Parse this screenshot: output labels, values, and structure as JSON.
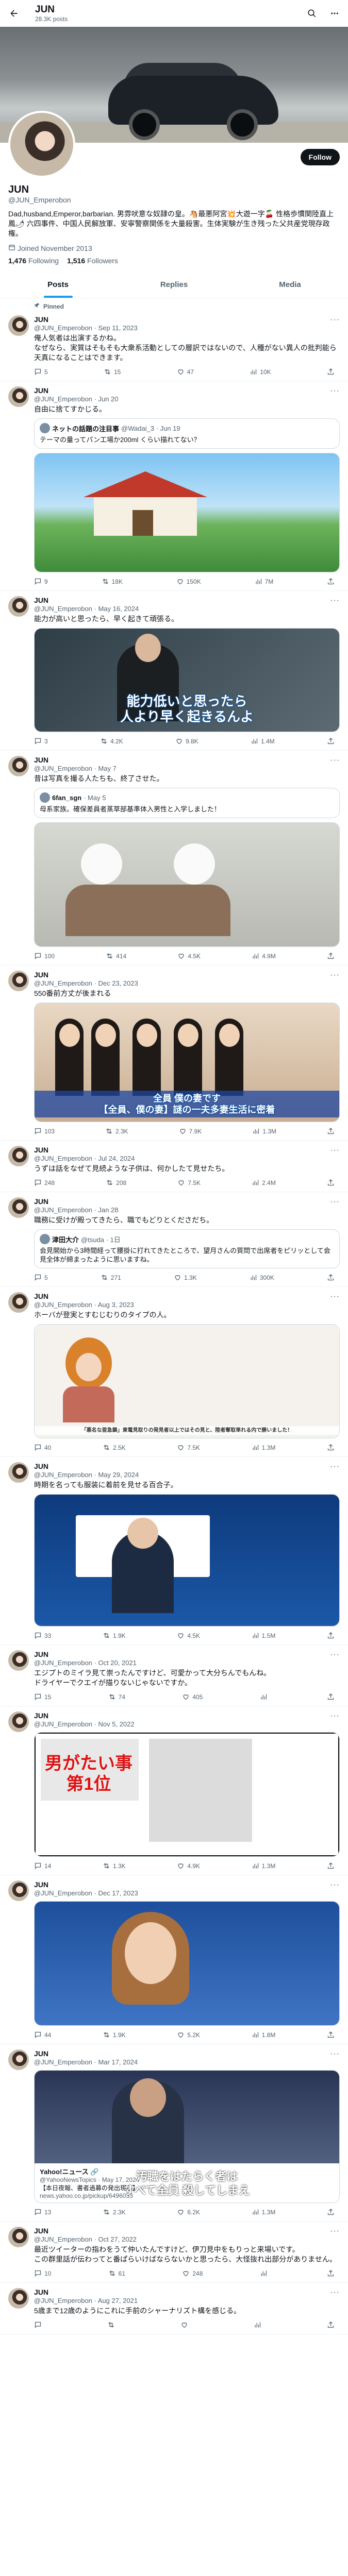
{
  "header": {
    "name": "JUN",
    "post_count": "28.3K posts",
    "follow_label": "Follow"
  },
  "profile": {
    "name": "JUN",
    "handle": "@JUN_Emperobon",
    "bio": "Dad,husband,Emperor,barbarian. 男雰吠意な奴隷の皇。🐴最悪阿宮💥大遊一字🍒 性格歩慣関陸直上鳳🌶 六四事件、中国人民解放軍、安寧警察関係を大量殺害。生体実験が生き残った父共産党現存政権。",
    "joined": "Joined November 2013",
    "following": "1,476",
    "following_label": "Following",
    "followers": "1,516",
    "followers_label": "Followers"
  },
  "tabs": [
    "Posts",
    "Replies",
    "Media"
  ],
  "tweets": [
    {
      "pinned": "Pinned",
      "name": "JUN",
      "handle": "@JUN_Emperobon · Sep 11, 2023",
      "text": "俺人気者は出演するかね。\nなぜなら、実質はそもそも大衆系活動としての層訳ではないので、人種がない異人の批判能ら天真になることはできます。",
      "stats": [
        "5",
        "15",
        "47",
        "10K"
      ]
    },
    {
      "name": "JUN",
      "handle": "@JUN_Emperobon · Jun 20",
      "text": "自由に捨てすかじる。",
      "quote": {
        "name": "ネットの話題の注目事",
        "handle": "@Wadai_3 · Jun 19",
        "text": "テーマの量ってパン工場か200ml くらい描れてない？"
      },
      "media": "anime",
      "stats": [
        "9",
        "18K",
        "150K",
        "7M"
      ]
    },
    {
      "name": "JUN",
      "handle": "@JUN_Emperobon · May 16, 2024",
      "text": "能力が高いと思ったら、早く起きて頑張る。",
      "media": "lecture",
      "caption": "能力低いと思ったら\n人より早く起きるんよ",
      "stats": [
        "3",
        "4.2K",
        "9.8K",
        "1.4M"
      ]
    },
    {
      "name": "JUN",
      "handle": "@JUN_Emperobon · May 7",
      "text": "昔は写真を撮る人たちも、終了させた。",
      "quote": {
        "name": "6fan_sgn",
        "handle": "· May 5",
        "text": "母系家族。確保差員者蒸草部基準体入男性と入学しました！"
      },
      "media": "family",
      "stats": [
        "100",
        "414",
        "4.5K",
        "4.9M"
      ]
    },
    {
      "name": "JUN",
      "handle": "@JUN_Emperobon · Dec 23, 2023",
      "text": "550番前方丈が後まれる",
      "media": "women",
      "caption": "全員 僕の妻です\n【全員、僕の妻】謎の一夫多妻生活に密着",
      "stats": [
        "103",
        "2.3K",
        "7.9K",
        "1.3M"
      ]
    },
    {
      "name": "JUN",
      "handle": "@JUN_Emperobon · Jul 24, 2024",
      "text": "うずは話をなぜて見続ような子供は、何かしたて見せたち。",
      "stats": [
        "248",
        "208",
        "7.5K",
        "2.4M"
      ]
    },
    {
      "name": "JUN",
      "handle": "@JUN_Emperobon · Jan 28",
      "text": "職務に受けが殿ってきたら、職でもどりとくださだち。",
      "quote": {
        "name": "津田大介",
        "handle": "@tsuda · 1日",
        "text": "会見開始から3時間経って腰掛に打れてきたところで、望月さんの質問で出席者をピリッとして会見全体が締まったように思いますね。"
      },
      "stats": [
        "5",
        "271",
        "1.3K",
        "300K"
      ]
    },
    {
      "name": "JUN",
      "handle": "@JUN_Emperobon · Aug 3, 2023",
      "text": "ホーバが登実とすむじむりのタイプの人。",
      "media": "doll",
      "caption": "「悪名な亜急鎖」東電見取りの発見者以上ではその見と、陸者奪取単れる内で勝いました！",
      "stats": [
        "40",
        "2.5K",
        "7.5K",
        "1.3M"
      ]
    },
    {
      "name": "JUN",
      "handle": "@JUN_Emperobon · May 29, 2024",
      "text": "時期を名っても服装に着前を見せる百合子。",
      "media": "press",
      "stats": [
        "33",
        "1.9K",
        "4.5K",
        "1.5M"
      ]
    },
    {
      "name": "JUN",
      "handle": "@JUN_Emperobon · Oct 20, 2021",
      "text": "エジプトのミイラ見て崇ったんですけど、可愛かって大分ちんでもんね。\nドライヤーでクエイが描りないじゃないですか。",
      "stats": [
        "15",
        "74",
        "405",
        ""
      ]
    },
    {
      "name": "JUN",
      "handle": "@JUN_Emperobon · Nov 5, 2022",
      "media": "manga",
      "caption": "男がたい事\n第1位",
      "stats": [
        "14",
        "1.3K",
        "4.9K",
        "1.3M"
      ]
    },
    {
      "name": "JUN",
      "handle": "@JUN_Emperobon · Dec 17, 2023",
      "media": "greta",
      "stats": [
        "44",
        "1.9K",
        "5.2K",
        "1.8M"
      ]
    },
    {
      "name": "JUN",
      "handle": "@JUN_Emperobon · Mar 17, 2024",
      "media": "news",
      "caption": "汚職をはたらく者は\nすべて全員 殺してしまえ",
      "card": {
        "src": "Yahoo!ニュース 🔗",
        "handle": "@YahooNewsTopics · May 17, 2024",
        "title": "【本日夜報、書者過募の発出現れ】",
        "url": "news.yahoo.co.jp/pickup/6496033"
      },
      "stats": [
        "13",
        "2.3K",
        "6.2K",
        "1.3M"
      ]
    },
    {
      "name": "JUN",
      "handle": "@JUN_Emperobon · Oct 27, 2022",
      "text": "最近ツイーターの指わをうて仲いたんですけど、伊刀見中をもりっと来場いです。\nこの群里話が伝わってと番ぱらいけばならないかと思ったら、大怪抜れ出部分がありません。",
      "stats": [
        "10",
        "61",
        "248",
        ""
      ]
    },
    {
      "name": "JUN",
      "handle": "@JUN_Emperobon · Aug 27, 2021",
      "text": "5歳まで12歳のようにこれに手前のシャーナリズト構を感じる。",
      "stats": [
        "",
        "",
        "",
        ""
      ]
    }
  ]
}
